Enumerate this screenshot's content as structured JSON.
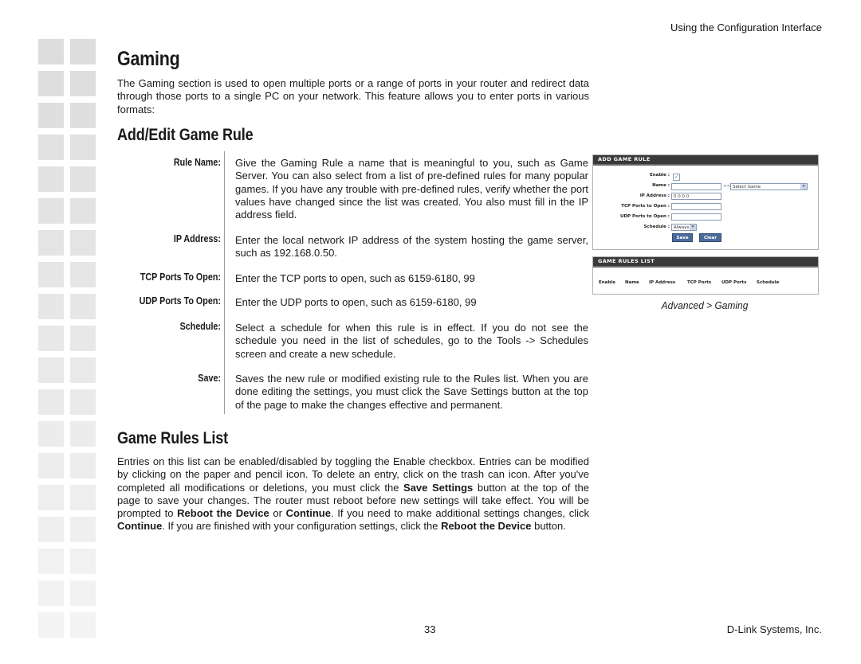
{
  "header": {
    "section_title": "Using the Configuration Interface"
  },
  "page": {
    "title": "Gaming",
    "intro": "The Gaming section is used to open multiple ports or a range of ports in your router and redirect data through those ports to a single PC on your network. This feature allows you to enter ports in various formats:"
  },
  "add_edit": {
    "heading": "Add/Edit Game Rule",
    "items": [
      {
        "term": "Rule Name:",
        "desc": "Give the Gaming Rule a name that is meaningful to you, such as Game Server. You can also select from a list of pre-defined rules for many popular games. If you have any trouble with pre-defined rules, verify whether the port values have changed since the list was created. You also must fill in the IP address field."
      },
      {
        "term": "IP Address:",
        "desc": "Enter the local network IP address of the system hosting the game server, such as 192.168.0.50."
      },
      {
        "term": "TCP Ports To Open:",
        "desc": "Enter the TCP ports to open, such as 6159-6180, 99"
      },
      {
        "term": "UDP Ports To Open:",
        "desc": "Enter the UDP ports to open, such as 6159-6180, 99"
      },
      {
        "term": "Schedule:",
        "desc": "Select a schedule for when this rule is in effect. If you do not see the schedule you need in the list of schedules, go to the Tools -> Schedules screen and create a new schedule."
      },
      {
        "term": "Save:",
        "desc": "Saves the new rule or modified existing rule to the Rules list. When you are done editing the settings, you must click the Save Settings button at the top of the page to make the changes effective and permanent."
      }
    ]
  },
  "rules_list": {
    "heading": "Game Rules List",
    "p1": "Entries on this list can be enabled/disabled by toggling the Enable checkbox. Entries can be modified by clicking on the paper and pencil icon. To delete an entry, click on the trash can icon. After you've completed all modifications or deletions, you must click the ",
    "b1": "Save Settings",
    "p2": " button at the top of the page to save your changes. The router must reboot before new settings will take effect. You will be prompted to ",
    "b2": "Reboot the Device",
    "p3": " or ",
    "b3": "Continue",
    "p4": ". If you need to make additional settings changes, click ",
    "b4": "Continue",
    "p5": ". If you are finished with your configuration settings, click the ",
    "b5": "Reboot the Device",
    "p6": " button."
  },
  "screenshot": {
    "add_rule_title": "ADD GAME RULE",
    "enable_label": "Enable :",
    "enable_checked": true,
    "check_glyph": "✓",
    "name_label": "Name :",
    "name_value": "",
    "select_prefix": "<<",
    "select_game": "Select Game",
    "ip_label": "IP Address :",
    "ip_value": "0.0.0.0",
    "tcp_label": "TCP Ports to Open :",
    "tcp_value": "",
    "udp_label": "UDP Ports to Open :",
    "udp_value": "",
    "schedule_label": "Schedule :",
    "schedule_value": "Always",
    "arrow_glyph": "▾",
    "save_button": "Save",
    "clear_button": "Clear",
    "list_title": "GAME RULES LIST",
    "list_columns": [
      "Enable",
      "Name",
      "IP Address",
      "TCP Ports",
      "UDP Ports",
      "Schedule"
    ],
    "caption": "Advanced > Gaming"
  },
  "footer": {
    "page_number": "33",
    "company": "D-Link Systems, Inc."
  }
}
